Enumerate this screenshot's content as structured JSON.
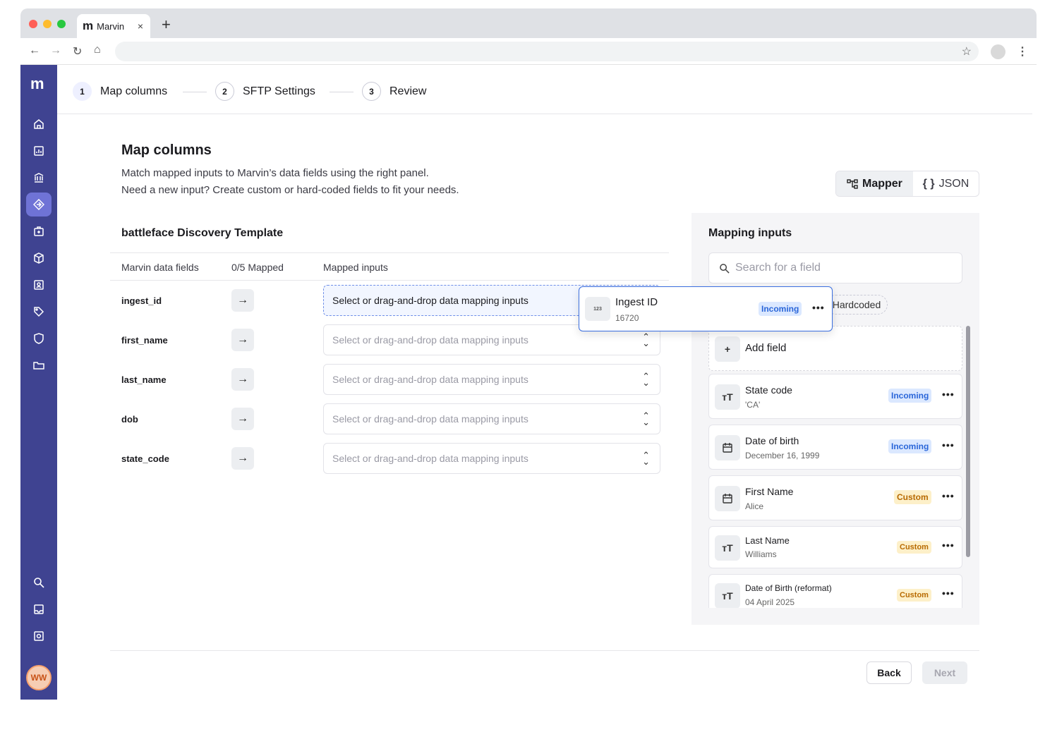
{
  "browser": {
    "tab_title": "Marvin",
    "tab_logo": "m",
    "close_glyph": "×",
    "new_tab_glyph": "+"
  },
  "app": {
    "brand": "m",
    "user_initials": "WW"
  },
  "icons": {
    "back": "arrow-left-icon",
    "forward": "arrow-right-icon",
    "reload": "reload-icon",
    "home": "home-icon",
    "bookmark": "star-icon",
    "menu": "kebab-icon"
  },
  "steps": [
    {
      "num": "1",
      "label": "Map columns"
    },
    {
      "num": "2",
      "label": "SFTP Settings"
    },
    {
      "num": "3",
      "label": "Review"
    }
  ],
  "page": {
    "title": "Map columns",
    "subtitle_1": "Match mapped inputs to Marvin’s data fields using the right panel.",
    "subtitle_2": "Need a new input? Create custom or hard-coded fields to fit your needs."
  },
  "view_toggle": {
    "mapper": "Mapper",
    "json": "JSON"
  },
  "template": {
    "title": "battleface Discovery Template",
    "col_fields": "Marvin data fields",
    "col_mapped": "0/5 Mapped",
    "col_inputs": "Mapped inputs",
    "rows": [
      {
        "field": "ingest_id",
        "placeholder": "Select or drag-and-drop data mapping inputs"
      },
      {
        "field": "first_name",
        "placeholder": "Select or drag-and-drop data mapping inputs"
      },
      {
        "field": "last_name",
        "placeholder": "Select or drag-and-drop data mapping inputs"
      },
      {
        "field": "dob",
        "placeholder": "Select or drag-and-drop data mapping inputs"
      },
      {
        "field": "state_code",
        "placeholder": "Select or drag-and-drop data mapping inputs"
      }
    ]
  },
  "drag_card": {
    "icon": "123",
    "title": "Ingest ID",
    "value": "16720",
    "badge": "Incoming",
    "more": "•••"
  },
  "panel": {
    "title": "Mapping inputs",
    "search_placeholder": "Search for a field",
    "chip": "Hardcoded",
    "add_field": "Add field",
    "cards": [
      {
        "icon": "TT",
        "title": "State code",
        "value": "'CA'",
        "badge": "Incoming"
      },
      {
        "icon": "calendar",
        "title": "Date of birth",
        "value": "December 16, 1999",
        "badge": "Incoming"
      },
      {
        "icon": "calendar",
        "title": "First Name",
        "value": "Alice",
        "badge": "Custom"
      },
      {
        "icon": "TT",
        "title": "Last Name",
        "value": "Williams",
        "badge": "Custom"
      },
      {
        "icon": "TT",
        "title": "Date of Birth (reformat)",
        "value": "04 April 2025",
        "badge": "Custom"
      }
    ]
  },
  "footer": {
    "back": "Back",
    "next": "Next"
  },
  "colors": {
    "rail": "#3f4391",
    "accent": "#3b6fe0",
    "incoming": "#2a66d9",
    "custom": "#b86a00"
  }
}
